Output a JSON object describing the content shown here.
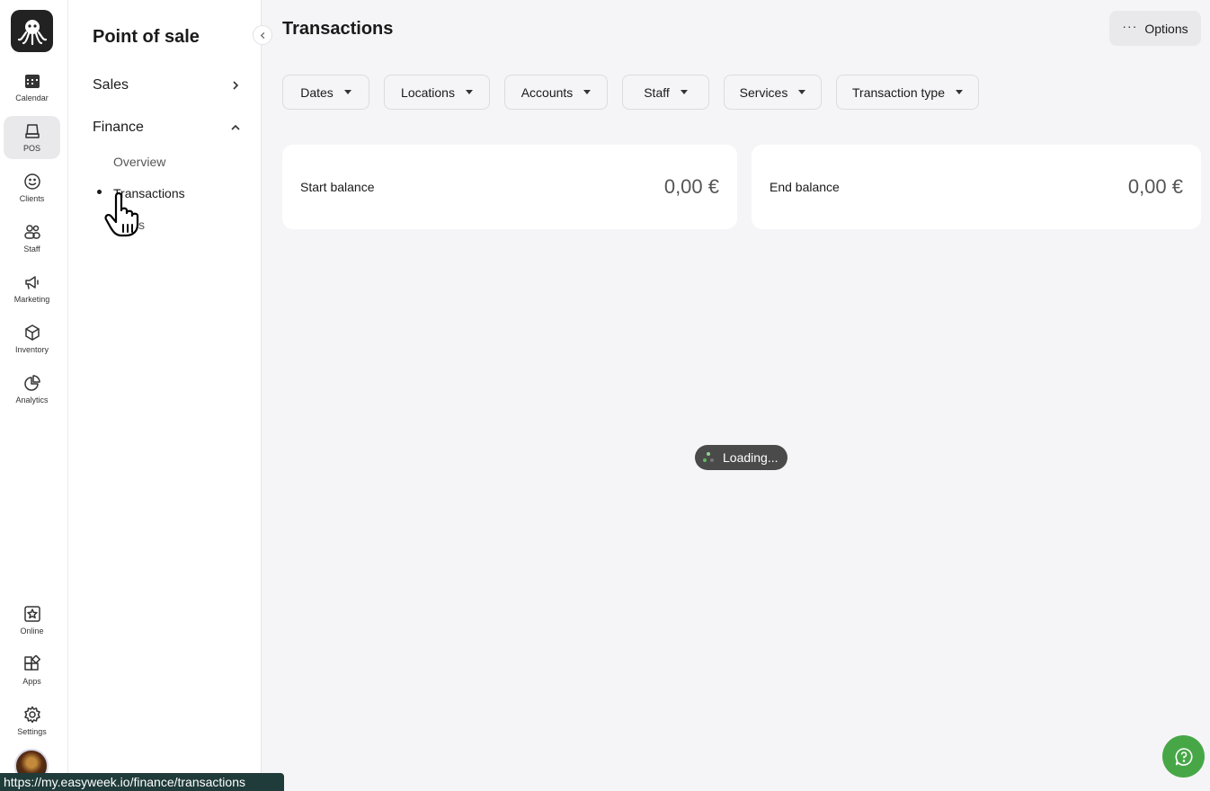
{
  "rail": {
    "items": [
      {
        "label": "Calendar",
        "icon": "calendar-icon"
      },
      {
        "label": "POS",
        "icon": "pos-icon",
        "active": true
      },
      {
        "label": "Clients",
        "icon": "smiley-icon"
      },
      {
        "label": "Staff",
        "icon": "people-icon"
      },
      {
        "label": "Marketing",
        "icon": "megaphone-icon"
      },
      {
        "label": "Inventory",
        "icon": "box-icon"
      },
      {
        "label": "Analytics",
        "icon": "pie-chart-icon"
      }
    ],
    "bottom_items": [
      {
        "label": "Online",
        "icon": "star-frame-icon"
      },
      {
        "label": "Apps",
        "icon": "apps-icon"
      },
      {
        "label": "Settings",
        "icon": "gear-icon"
      }
    ]
  },
  "sidebar": {
    "title": "Point of sale",
    "sections": [
      {
        "label": "Sales",
        "expanded": false
      },
      {
        "label": "Finance",
        "expanded": true
      }
    ],
    "finance_items": [
      {
        "label": "Overview"
      },
      {
        "label": "Transactions",
        "active": true
      },
      {
        "label": "s"
      }
    ]
  },
  "header": {
    "title": "Transactions",
    "options_label": "Options"
  },
  "filters": [
    "Dates",
    "Locations",
    "Accounts",
    "Staff",
    "Services",
    "Transaction type"
  ],
  "balances": {
    "start_label": "Start balance",
    "start_value": "0,00 €",
    "end_label": "End balance",
    "end_value": "0,00 €"
  },
  "loading_text": "Loading...",
  "status_url": "https://my.easyweek.io/finance/transactions",
  "colors": {
    "accent_green": "#47a747",
    "status_bar": "#1f3b3a"
  }
}
